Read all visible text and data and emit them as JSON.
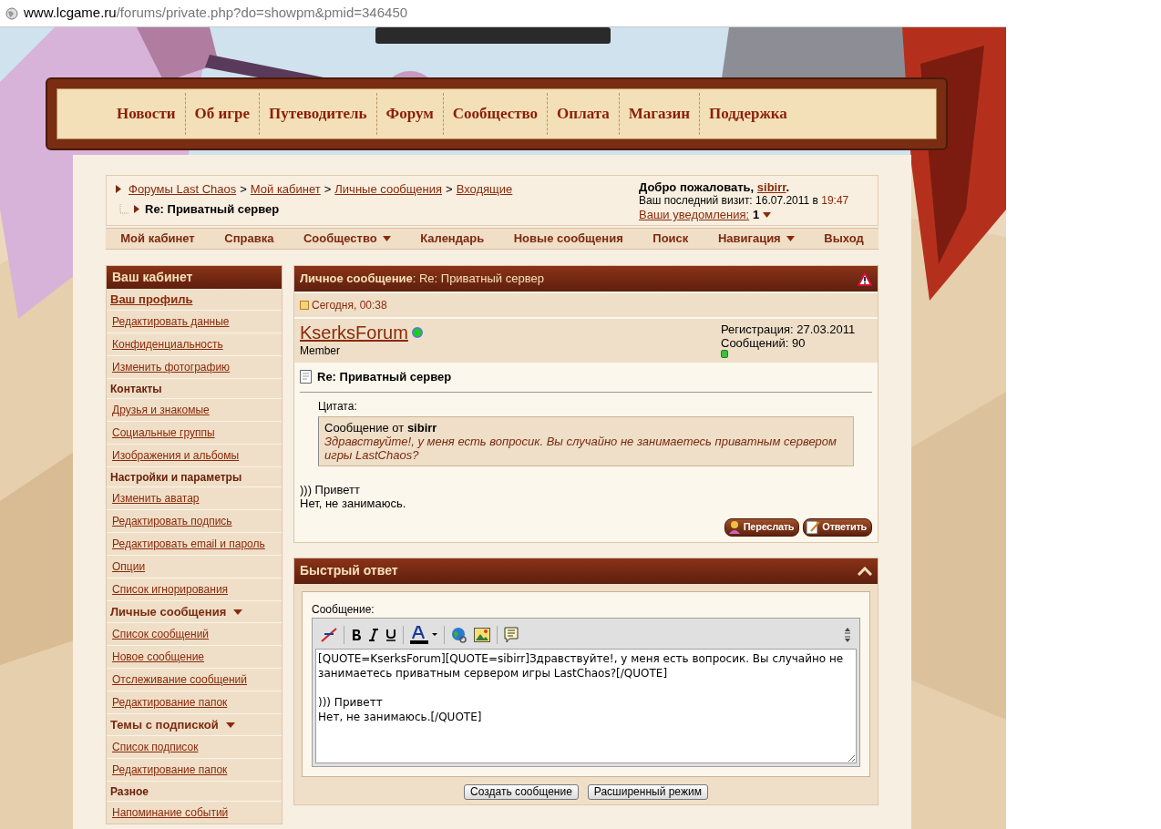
{
  "address_bar": {
    "domain": "www.lcgame.ru",
    "path": "/forums/private.php?do=showpm&pmid=346450"
  },
  "site_nav": [
    "Новости",
    "Об игре",
    "Путеводитель",
    "Форум",
    "Сообщество",
    "Оплата",
    "Магазин",
    "Поддержка"
  ],
  "breadcrumb": {
    "separator": ">",
    "links": [
      "Форумы Last Chaos",
      "Мой кабинет",
      "Личные сообщения",
      "Входящие"
    ],
    "current": "Re: Приватный сервер"
  },
  "welcome": {
    "prefix": "Добро пожаловать,",
    "user": "sibirr",
    "suffix": ".",
    "last_visit": "Ваш последний визит: 16.07.2011 в",
    "last_visit_time": "19:47",
    "notifications": "Ваши уведомления:",
    "notification_count": "1"
  },
  "forum_nav": [
    {
      "label": "Мой кабинет",
      "dropdown": false
    },
    {
      "label": "Справка",
      "dropdown": false
    },
    {
      "label": "Сообщество",
      "dropdown": true
    },
    {
      "label": "Календарь",
      "dropdown": false
    },
    {
      "label": "Новые сообщения",
      "dropdown": false
    },
    {
      "label": "Поиск",
      "dropdown": false
    },
    {
      "label": "Навигация",
      "dropdown": true
    },
    {
      "label": "Выход",
      "dropdown": false
    }
  ],
  "sidebar": {
    "title": "Ваш кабинет",
    "items": [
      {
        "kind": "section_link",
        "label": "Ваш профиль"
      },
      {
        "kind": "link",
        "label": "Редактировать данные"
      },
      {
        "kind": "link",
        "label": "Конфиденциальность"
      },
      {
        "kind": "link",
        "label": "Изменить фотографию"
      },
      {
        "kind": "section",
        "label": "Контакты"
      },
      {
        "kind": "link",
        "label": "Друзья и знакомые"
      },
      {
        "kind": "link",
        "label": "Социальные группы"
      },
      {
        "kind": "link",
        "label": "Изображения и альбомы"
      },
      {
        "kind": "section",
        "label": "Настройки и параметры"
      },
      {
        "kind": "link",
        "label": "Изменить аватар"
      },
      {
        "kind": "link",
        "label": "Редактировать подпись"
      },
      {
        "kind": "link",
        "label": "Редактировать email и пароль"
      },
      {
        "kind": "link",
        "label": "Опции"
      },
      {
        "kind": "link",
        "label": "Список игнорирования"
      },
      {
        "kind": "section_menu",
        "label": "Личные сообщения"
      },
      {
        "kind": "link",
        "label": "Список сообщений"
      },
      {
        "kind": "link",
        "label": "Новое сообщение"
      },
      {
        "kind": "link",
        "label": "Отслеживание сообщений"
      },
      {
        "kind": "link",
        "label": "Редактирование папок"
      },
      {
        "kind": "section_menu",
        "label": "Темы с подпиской"
      },
      {
        "kind": "link",
        "label": "Список подписок"
      },
      {
        "kind": "link",
        "label": "Редактирование папок"
      },
      {
        "kind": "section",
        "label": "Разное"
      },
      {
        "kind": "link",
        "label": "Напоминание событий"
      }
    ]
  },
  "message": {
    "header": "**Личное сообщение**: Re: Приватный сервер",
    "date": "Сегодня, 00:38",
    "author": "KserksForum",
    "online": true,
    "role": "Member",
    "registration": "Регистрация: 27.03.2011",
    "posts": "Сообщений: 90",
    "title": "Re: Приватный сервер",
    "quote_label": "Цитата:",
    "quote_author": "Сообщение от **sibirr**",
    "quote_text": "Здравствуйте!, у меня есть вопросик. Вы случайно не занимаетесь приватным сервером игры LastChaos?",
    "body": [
      "))) Приветт",
      "Нет, не занимаюсь."
    ],
    "buttons": [
      "Переслать",
      "Ответить"
    ]
  },
  "quick_reply": {
    "title": "Быстрый ответ",
    "label": "Сообщение:",
    "value": "[QUOTE=KserksForum][QUOTE=sibirr]Здравствуйте!, у меня есть вопросик. Вы случайно не занимаетесь приватным сервером игры LastChaos?[/QUOTE]\n\n))) Приветт\nНет, не занимаюсь.[/QUOTE]",
    "buttons": [
      "Создать сообщение",
      "Расширенный режим"
    ]
  }
}
